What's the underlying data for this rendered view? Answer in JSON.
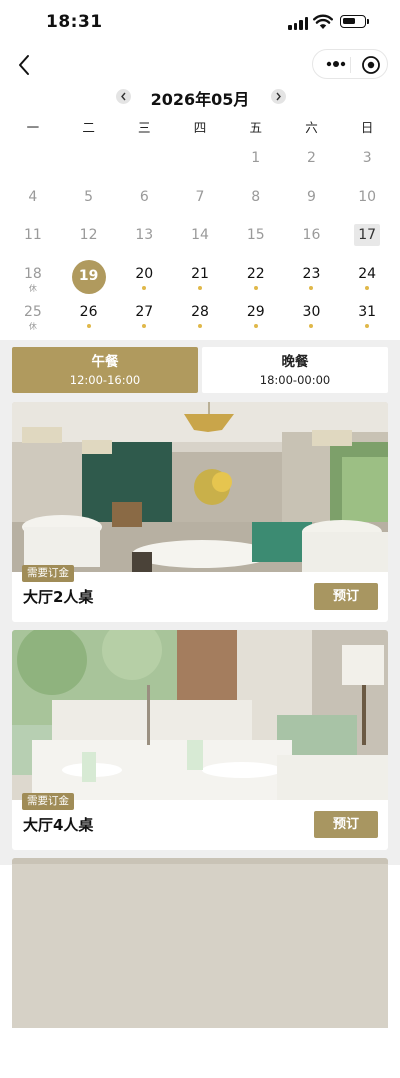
{
  "status_bar": {
    "time": "18:31"
  },
  "nav": {
    "back_icon": "chevron-left-icon",
    "capsule_icons": [
      "more-dots-icon",
      "target-circle-icon"
    ]
  },
  "calendar": {
    "month_title": "2026年05月",
    "weekdays": [
      "一",
      "二",
      "三",
      "四",
      "五",
      "六",
      "日"
    ],
    "rows": [
      [
        {
          "d": ""
        },
        {
          "d": ""
        },
        {
          "d": ""
        },
        {
          "d": ""
        },
        {
          "d": "1",
          "s": "past"
        },
        {
          "d": "2",
          "s": "past"
        },
        {
          "d": "3",
          "s": "past"
        }
      ],
      [
        {
          "d": "4",
          "s": "past"
        },
        {
          "d": "5",
          "s": "past"
        },
        {
          "d": "6",
          "s": "past"
        },
        {
          "d": "7",
          "s": "past"
        },
        {
          "d": "8",
          "s": "past"
        },
        {
          "d": "9",
          "s": "past"
        },
        {
          "d": "10",
          "s": "past"
        }
      ],
      [
        {
          "d": "11",
          "s": "past"
        },
        {
          "d": "12",
          "s": "past"
        },
        {
          "d": "13",
          "s": "past"
        },
        {
          "d": "14",
          "s": "past"
        },
        {
          "d": "15",
          "s": "past"
        },
        {
          "d": "16",
          "s": "past"
        },
        {
          "d": "17",
          "s": "today"
        }
      ],
      [
        {
          "d": "18",
          "s": "past",
          "sub": "休"
        },
        {
          "d": "19",
          "s": "selected"
        },
        {
          "d": "20",
          "s": "avail"
        },
        {
          "d": "21",
          "s": "avail"
        },
        {
          "d": "22",
          "s": "avail"
        },
        {
          "d": "23",
          "s": "avail"
        },
        {
          "d": "24",
          "s": "avail"
        }
      ],
      [
        {
          "d": "25",
          "s": "past",
          "sub": "休"
        },
        {
          "d": "26",
          "s": "avail"
        },
        {
          "d": "27",
          "s": "avail"
        },
        {
          "d": "28",
          "s": "avail"
        },
        {
          "d": "29",
          "s": "avail"
        },
        {
          "d": "30",
          "s": "avail"
        },
        {
          "d": "31",
          "s": "avail"
        }
      ]
    ]
  },
  "meal_tabs": {
    "lunch": {
      "label": "午餐",
      "time": "12:00-16:00"
    },
    "dinner": {
      "label": "晚餐",
      "time": "18:00-00:00"
    }
  },
  "tables": [
    {
      "badge": "需要订金",
      "name": "大厅2人桌",
      "button": "预订"
    },
    {
      "badge": "需要订金",
      "name": "大厅4人桌",
      "button": "预订"
    }
  ],
  "colors": {
    "accent": "#b09a5e",
    "button": "#a89661",
    "dot": "#e0b84a",
    "section_bg": "#efefef"
  }
}
